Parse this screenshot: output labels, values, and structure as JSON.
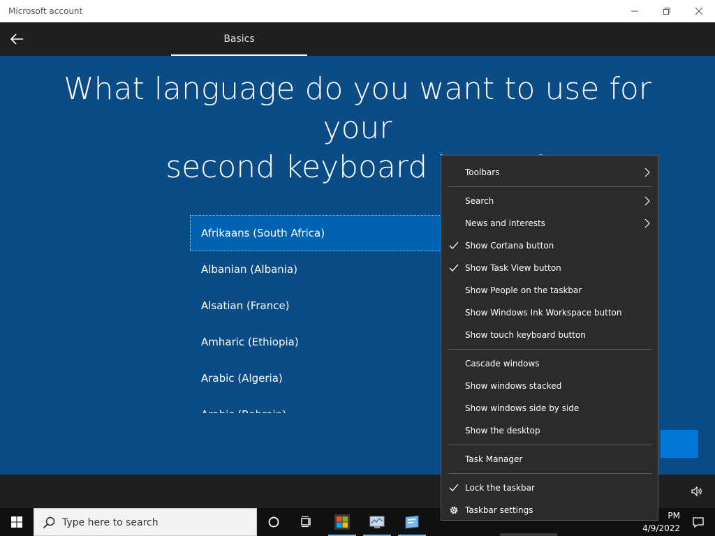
{
  "window": {
    "title": "Microsoft account"
  },
  "nav": {
    "tab_label": "Basics"
  },
  "main": {
    "question_line1": "What language do you want to use for your",
    "question_line2": "second keyboard layout?",
    "languages": [
      "Afrikaans (South Africa)",
      "Albanian (Albania)",
      "Alsatian (France)",
      "Amharic (Ethiopia)",
      "Arabic (Algeria)",
      "Arabic (Bahrain)"
    ],
    "selected_language": "Afrikaans (South Africa)"
  },
  "context_menu": {
    "items": [
      {
        "label": "Toolbars",
        "submenu": true,
        "checked": false
      },
      {
        "label": "Search",
        "submenu": true,
        "checked": false
      },
      {
        "label": "News and interests",
        "submenu": true,
        "checked": false
      },
      {
        "label": "Show Cortana button",
        "submenu": false,
        "checked": true
      },
      {
        "label": "Show Task View button",
        "submenu": false,
        "checked": true
      },
      {
        "label": "Show People on the taskbar",
        "submenu": false,
        "checked": false
      },
      {
        "label": "Show Windows Ink Workspace button",
        "submenu": false,
        "checked": false
      },
      {
        "label": "Show touch keyboard button",
        "submenu": false,
        "checked": false
      },
      {
        "label": "Cascade windows",
        "submenu": false,
        "checked": false
      },
      {
        "label": "Show windows stacked",
        "submenu": false,
        "checked": false
      },
      {
        "label": "Show windows side by side",
        "submenu": false,
        "checked": false
      },
      {
        "label": "Show the desktop",
        "submenu": false,
        "checked": false
      },
      {
        "label": "Task Manager",
        "submenu": false,
        "checked": false
      },
      {
        "label": "Lock the taskbar",
        "submenu": false,
        "checked": true
      },
      {
        "label": "Taskbar settings",
        "submenu": false,
        "checked": false,
        "icon": "gear-icon"
      }
    ]
  },
  "taskbar": {
    "search_placeholder": "Type here to search",
    "clock_time": "PM",
    "clock_date": "4/9/2022"
  },
  "colors": {
    "oobe_background": "#0b4b86",
    "selection": "#0063b1",
    "accent": "#0078d7",
    "menu_background": "#2b2b2b"
  }
}
